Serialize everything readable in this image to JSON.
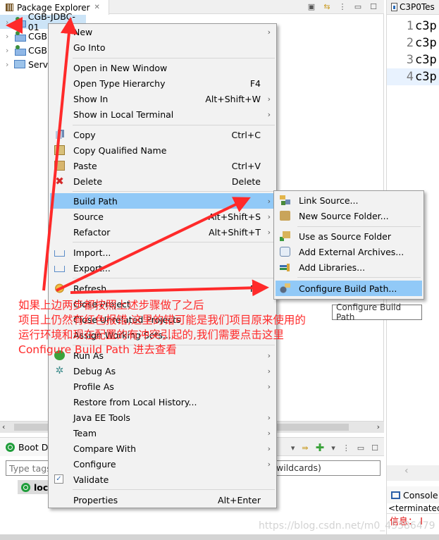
{
  "package_explorer": {
    "tab_title": "Package Explorer",
    "tree": [
      {
        "label": "CGB-JDBC-01",
        "selected": true
      },
      {
        "label": "CGB",
        "warning": true
      },
      {
        "label": "CGB"
      },
      {
        "label": "Serv",
        "type": "folder"
      }
    ]
  },
  "editor": {
    "tab_title": "C3P0Tes",
    "lines": [
      {
        "num": "1",
        "text": "c3p"
      },
      {
        "num": "2",
        "text": "c3p"
      },
      {
        "num": "3",
        "text": "c3p"
      },
      {
        "num": "4",
        "text": "c3p"
      }
    ]
  },
  "boot_dashboard": {
    "tab_title": "Boot D",
    "filter_placeholder": "Type tags",
    "filter_suffix": "wildcards)",
    "item_label": "loca"
  },
  "console": {
    "tab_title": "Console",
    "status": "<terminated",
    "output": "信息： I"
  },
  "context_menu": {
    "items": [
      {
        "label": "New",
        "submenu": true
      },
      {
        "label": "Go Into"
      },
      {
        "label": "Open in New Window"
      },
      {
        "label": "Open Type Hierarchy",
        "accel": "F4"
      },
      {
        "label": "Show In",
        "accel": "Alt+Shift+W",
        "submenu": true
      },
      {
        "label": "Show in Local Terminal",
        "submenu": true
      },
      {
        "label": "Copy",
        "accel": "Ctrl+C",
        "icon": "copy-icon"
      },
      {
        "label": "Copy Qualified Name",
        "icon": "copy-qualified-name-icon"
      },
      {
        "label": "Paste",
        "accel": "Ctrl+V",
        "icon": "paste-icon"
      },
      {
        "label": "Delete",
        "accel": "Delete",
        "icon": "delete-icon"
      },
      {
        "label": "Build Path",
        "submenu": true,
        "highlighted": true
      },
      {
        "label": "Source",
        "accel": "Alt+Shift+S",
        "submenu": true
      },
      {
        "label": "Refactor",
        "accel": "Alt+Shift+T",
        "submenu": true
      },
      {
        "label": "Import...",
        "icon": "import-icon"
      },
      {
        "label": "Export...",
        "icon": "export-icon"
      },
      {
        "label": "Refresh",
        "accel": "F5",
        "icon": "refresh-icon"
      },
      {
        "label": "Close Project"
      },
      {
        "label": "Close Unrelated Projects"
      },
      {
        "label": "Assign Working Sets..."
      },
      {
        "label": "Run As",
        "submenu": true,
        "icon": "run-icon"
      },
      {
        "label": "Debug As",
        "submenu": true,
        "icon": "debug-icon"
      },
      {
        "label": "Profile As",
        "submenu": true
      },
      {
        "label": "Restore from Local History..."
      },
      {
        "label": "Java EE Tools",
        "submenu": true
      },
      {
        "label": "Team",
        "submenu": true
      },
      {
        "label": "Compare With",
        "submenu": true
      },
      {
        "label": "Configure",
        "submenu": true
      },
      {
        "label": "Validate",
        "checked": true
      },
      {
        "label": "Properties",
        "accel": "Alt+Enter"
      }
    ]
  },
  "build_path_submenu": {
    "items": [
      {
        "label": "Link Source..."
      },
      {
        "label": "New Source Folder..."
      },
      {
        "label": "Use as Source Folder"
      },
      {
        "label": "Add External Archives..."
      },
      {
        "label": "Add Libraries..."
      },
      {
        "label": "Configure Build Path...",
        "highlighted": true
      }
    ]
  },
  "tooltip": "Configure Build Path",
  "annotation": {
    "lines": [
      "如果上边两步都按照上述步骤做了之后",
      "项目上仍然有红色报错,这里的错可能是我们项目原来使用的",
      "运行环境和现在配置的有冲突引起的,我们需要点击这里",
      "Configure Build Path 进去查看"
    ],
    "color": "#ff2a2a"
  },
  "watermark": "https://blog.csdn.net/m0_45386479"
}
